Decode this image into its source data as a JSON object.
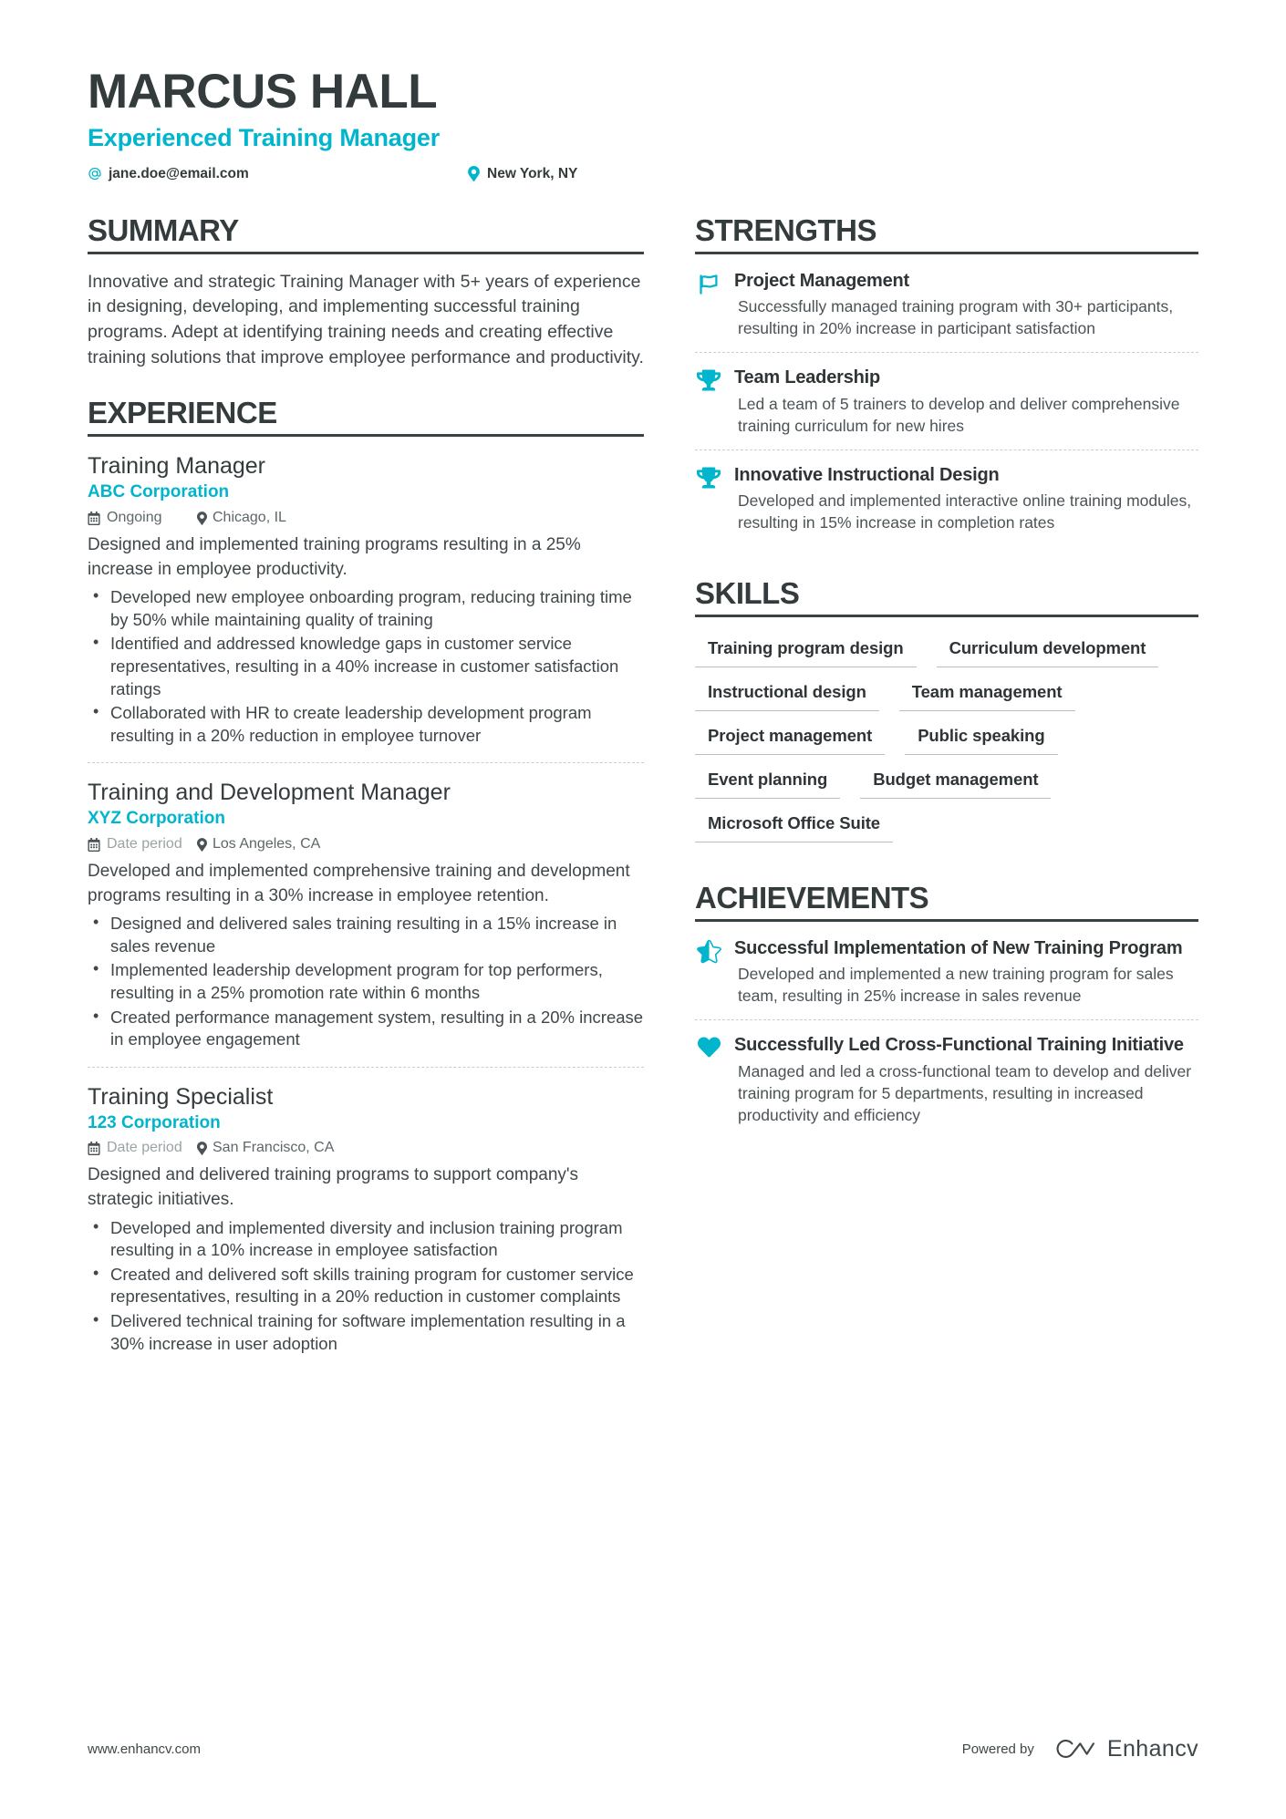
{
  "theme": {
    "accent": "#00b5cc",
    "text": "#2f3437",
    "muted": "#5d6769",
    "rule": "#3b4244"
  },
  "header": {
    "name": "MARCUS HALL",
    "title": "Experienced Training Manager",
    "contacts": [
      {
        "icon": "at-icon",
        "value": "jane.doe@email.com"
      },
      {
        "icon": "location-pin-icon",
        "value": "New York, NY"
      }
    ]
  },
  "summary": {
    "heading": "SUMMARY",
    "text": "Innovative and strategic Training Manager with 5+ years of experience in designing, developing, and implementing successful training programs. Adept at identifying training needs and creating effective training solutions that improve employee performance and productivity."
  },
  "experience": {
    "heading": "EXPERIENCE",
    "items": [
      {
        "role": "Training Manager",
        "company": "ABC Corporation",
        "date": "Ongoing",
        "date_muted": false,
        "location": "Chicago, IL",
        "description": "Designed and implemented training programs resulting in a 25% increase in employee productivity.",
        "bullets": [
          "Developed new employee onboarding program, reducing training time by 50% while maintaining quality of training",
          "Identified and addressed knowledge gaps in customer service representatives, resulting in a 40% increase in customer satisfaction ratings",
          "Collaborated with HR to create leadership development program resulting in a 20% reduction in employee turnover"
        ]
      },
      {
        "role": "Training and Development Manager",
        "company": "XYZ Corporation",
        "date": "Date period",
        "date_muted": true,
        "location": "Los Angeles, CA",
        "description": "Developed and implemented comprehensive training and development programs resulting in a 30% increase in employee retention.",
        "bullets": [
          "Designed and delivered sales training resulting in a 15% increase in sales revenue",
          "Implemented leadership development program for top performers, resulting in a 25% promotion rate within 6 months",
          "Created performance management system, resulting in a 20% increase in employee engagement"
        ]
      },
      {
        "role": "Training Specialist",
        "company": "123 Corporation",
        "date": "Date period",
        "date_muted": true,
        "location": "San Francisco, CA",
        "description": "Designed and delivered training programs to support company's strategic initiatives.",
        "bullets": [
          "Developed and implemented diversity and inclusion training program resulting in a 10% increase in employee satisfaction",
          "Created and delivered soft skills training program for customer service representatives, resulting in a 20% reduction in customer complaints",
          "Delivered technical training for software implementation resulting in a 30% increase in user adoption"
        ]
      }
    ]
  },
  "strengths": {
    "heading": "STRENGTHS",
    "items": [
      {
        "icon": "flag-icon",
        "title": "Project Management",
        "description": "Successfully managed training program with 30+ participants, resulting in 20% increase in participant satisfaction"
      },
      {
        "icon": "trophy-icon",
        "title": "Team Leadership",
        "description": "Led a team of 5 trainers to develop and deliver comprehensive training curriculum for new hires"
      },
      {
        "icon": "trophy-icon",
        "title": "Innovative Instructional Design",
        "description": "Developed and implemented interactive online training modules, resulting in 15% increase in completion rates"
      }
    ]
  },
  "skills": {
    "heading": "SKILLS",
    "items": [
      "Training program design",
      "Curriculum development",
      "Instructional design",
      "Team management",
      "Project management",
      "Public speaking",
      "Event planning",
      "Budget management",
      "Microsoft Office Suite"
    ]
  },
  "achievements": {
    "heading": "ACHIEVEMENTS",
    "items": [
      {
        "icon": "half-star-icon",
        "title": "Successful Implementation of New Training Program",
        "description": "Developed and implemented a new training program for sales team, resulting in 25% increase in sales revenue"
      },
      {
        "icon": "heart-icon",
        "title": "Successfully Led Cross-Functional Training Initiative",
        "description": "Managed and led a cross-functional team to develop and deliver training program for 5 departments, resulting in increased productivity and efficiency"
      }
    ]
  },
  "footer": {
    "website": "www.enhancv.com",
    "powered_by": "Powered by",
    "brand": "Enhancv"
  }
}
